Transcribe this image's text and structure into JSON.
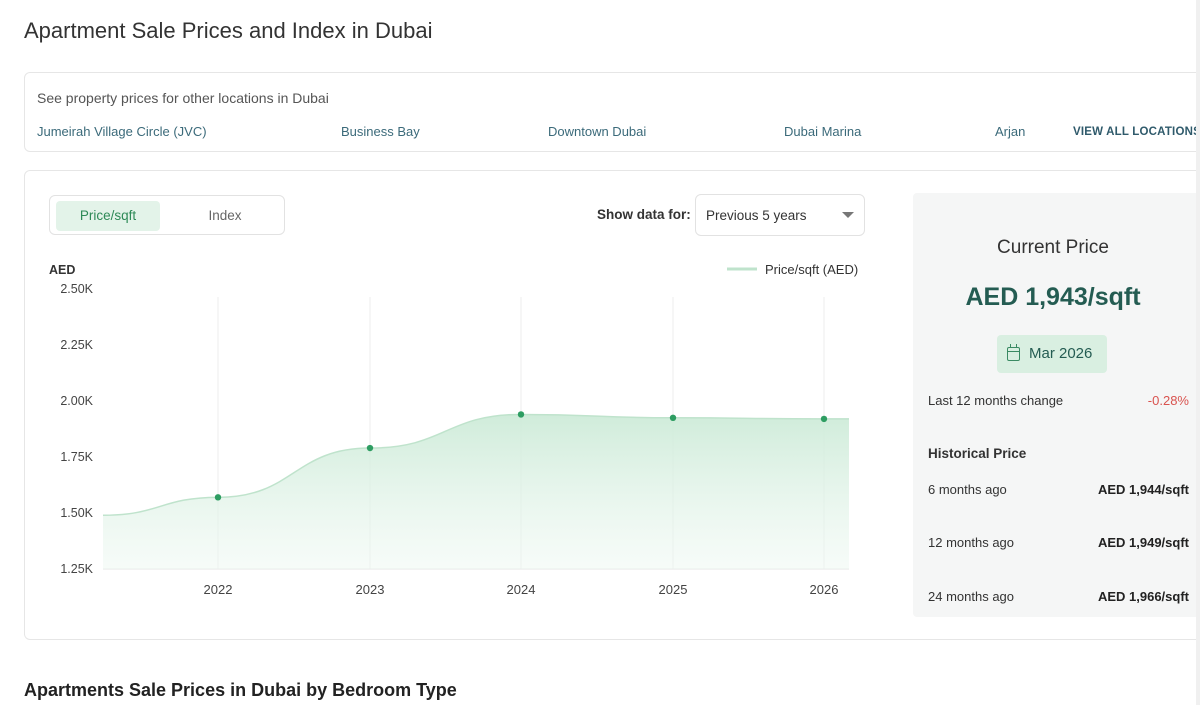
{
  "page_title": "Apartment Sale Prices and Index in Dubai",
  "locations": {
    "hint": "See property prices for other locations in Dubai",
    "links": [
      "Jumeirah Village Circle (JVC)",
      "Business Bay",
      "Downtown Dubai",
      "Dubai Marina",
      "Arjan"
    ],
    "view_all": "VIEW ALL LOCATIONS"
  },
  "toggle": {
    "options": [
      "Price/sqft",
      "Index"
    ],
    "active": "Price/sqft"
  },
  "filter": {
    "label": "Show data for:",
    "value": "Previous 5 years"
  },
  "chart_data": {
    "type": "area",
    "ylabel": "AED",
    "legend": "Price/sqft (AED)",
    "legend_position": "top-right",
    "grid": "vertical-lines",
    "y_ticks": [
      "2.50K",
      "2.25K",
      "2.00K",
      "1.75K",
      "1.50K",
      "1.25K"
    ],
    "ylim": [
      1250,
      2500
    ],
    "x_ticks": [
      "2022",
      "2023",
      "2024",
      "2025",
      "2026"
    ],
    "points": [
      {
        "x": "2022",
        "y": 1570
      },
      {
        "x": "2023",
        "y": 1790
      },
      {
        "x": "2024",
        "y": 1940
      },
      {
        "x": "2025",
        "y": 1925
      },
      {
        "x": "2026",
        "y": 1920
      }
    ],
    "line_color": "#2e9d62",
    "fill_color": "#dff2e6"
  },
  "current_price": {
    "title": "Current Price",
    "value": "AED 1,943/sqft",
    "date": "Mar 2026",
    "change_label": "Last 12 months change",
    "change_value": "-0.28%"
  },
  "historical": {
    "title": "Historical Price",
    "rows": [
      {
        "label": "6 months ago",
        "value": "AED 1,944/sqft"
      },
      {
        "label": "12 months ago",
        "value": "AED 1,949/sqft"
      },
      {
        "label": "24 months ago",
        "value": "AED 1,966/sqft"
      }
    ]
  },
  "section_title": "Apartments Sale Prices in Dubai by Bedroom Type",
  "colors": {
    "accent": "#2e9d62",
    "price_text": "#245c52",
    "negative": "#d9534f",
    "link": "#3b6a7a"
  }
}
